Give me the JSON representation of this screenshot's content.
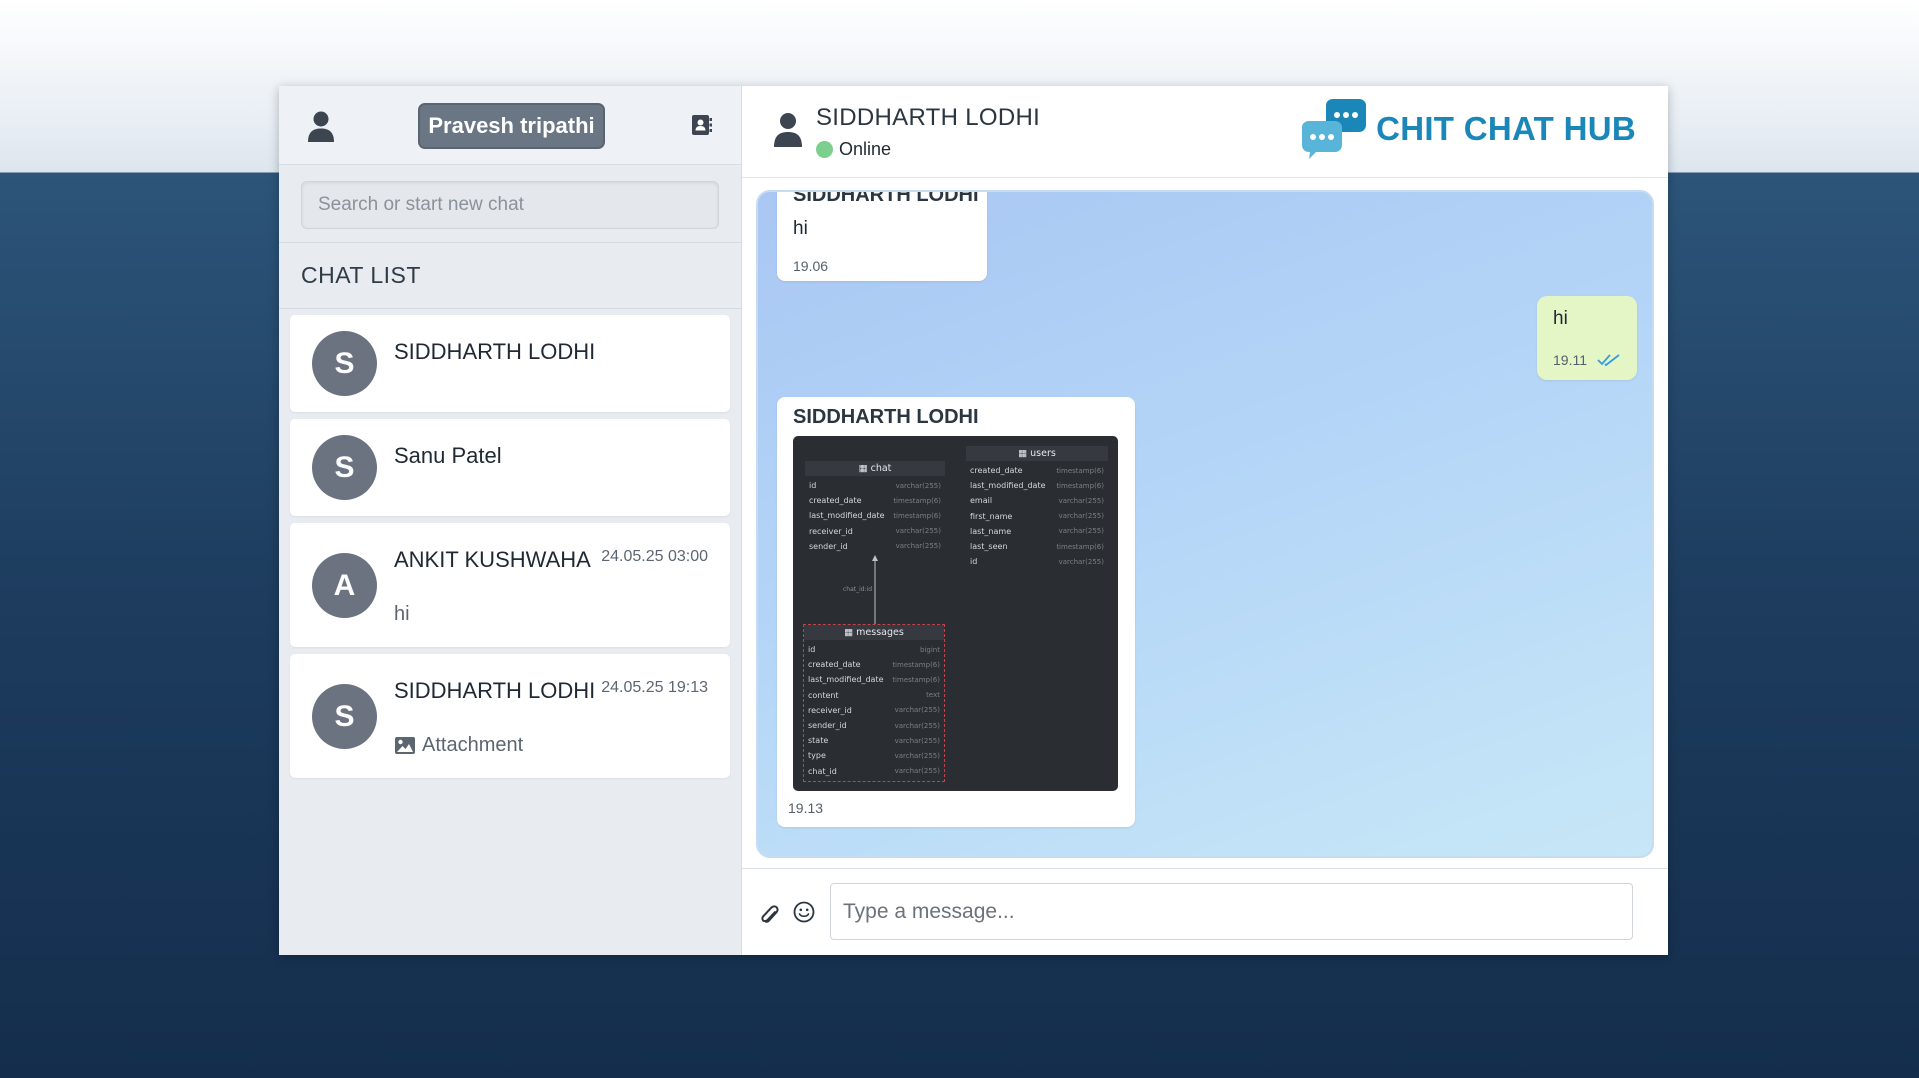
{
  "sidebar": {
    "current_user": "Pravesh tripathi",
    "search_placeholder": "Search or start new chat",
    "chat_list_title": "CHAT LIST",
    "chats": [
      {
        "initial": "S",
        "name": "SIDDHARTH LODHI",
        "time": "",
        "last": ""
      },
      {
        "initial": "S",
        "name": "Sanu Patel",
        "time": "",
        "last": ""
      },
      {
        "initial": "A",
        "name": "ANKIT KUSHWAHA",
        "time": "24.05.25 03:00",
        "last": "hi"
      },
      {
        "initial": "S",
        "name": "SIDDHARTH LODHI",
        "time": "24.05.25 19:13",
        "last": "Attachment"
      }
    ]
  },
  "header": {
    "peer_name": "SIDDHARTH LODHI",
    "peer_status": "Online",
    "brand": "CHIT CHAT HUB"
  },
  "messages": [
    {
      "direction": "in",
      "sender": "SIDDHARTH LODHI",
      "text": "hi",
      "time": "19.06"
    },
    {
      "direction": "out",
      "text": "hi",
      "time": "19.11"
    },
    {
      "direction": "in",
      "sender": "SIDDHARTH LODHI",
      "attachment": "image",
      "time": "19.13"
    }
  ],
  "schema_image": {
    "chat": {
      "title": "chat",
      "fields": [
        [
          "id",
          "varchar(255)"
        ],
        [
          "created_date",
          "timestamp(6)"
        ],
        [
          "last_modified_date",
          "timestamp(6)"
        ],
        [
          "receiver_id",
          "varchar(255)"
        ],
        [
          "sender_id",
          "varchar(255)"
        ]
      ]
    },
    "users": {
      "title": "users",
      "fields": [
        [
          "created_date",
          "timestamp(6)"
        ],
        [
          "last_modified_date",
          "timestamp(6)"
        ],
        [
          "email",
          "varchar(255)"
        ],
        [
          "first_name",
          "varchar(255)"
        ],
        [
          "last_name",
          "varchar(255)"
        ],
        [
          "last_seen",
          "timestamp(6)"
        ],
        [
          "id",
          "varchar(255)"
        ]
      ]
    },
    "messages": {
      "title": "messages",
      "fields": [
        [
          "id",
          "bigint"
        ],
        [
          "created_date",
          "timestamp(6)"
        ],
        [
          "last_modified_date",
          "timestamp(6)"
        ],
        [
          "content",
          "text"
        ],
        [
          "receiver_id",
          "varchar(255)"
        ],
        [
          "sender_id",
          "varchar(255)"
        ],
        [
          "state",
          "varchar(255)"
        ],
        [
          "type",
          "varchar(255)"
        ],
        [
          "chat_id",
          "varchar(255)"
        ]
      ]
    },
    "relation_label": "chat_id:id"
  },
  "composer": {
    "placeholder": "Type a message..."
  },
  "colors": {
    "brand": "#1b87b9",
    "online": "#7dcf8e",
    "avatar": "#6b7280",
    "outgoing_bubble": "#e4f5c6"
  },
  "icons": [
    "user-icon",
    "contacts-icon",
    "chat-bubbles-logo-icon",
    "double-check-icon",
    "image-icon",
    "paperclip-icon",
    "emoji-icon"
  ]
}
